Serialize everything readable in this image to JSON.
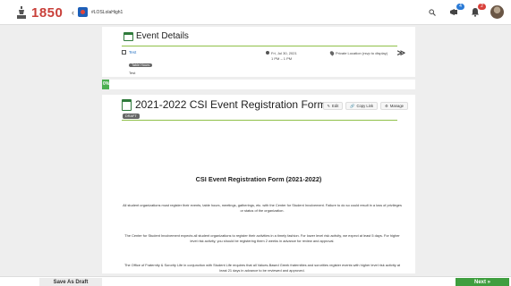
{
  "header": {
    "logo_text": "1850",
    "org_name": "#LOSLolaHigh1",
    "notification_badge": "4",
    "message_badge": "2"
  },
  "event_details": {
    "title": "Event Details",
    "event_link": "Test",
    "event_tag": "Table Hours",
    "event_sub": "Test",
    "date": "Fri, Jul 30, 2021",
    "time": "1 PM – 1 PM",
    "location": "Private Location (rsvp to display)"
  },
  "progress": {
    "label": "0%",
    "value_percent": 0
  },
  "form": {
    "title": "2021-2022 CSI Event Registration Form",
    "status": "DRAFT",
    "actions": {
      "edit": "Edit",
      "copy_link": "Copy Link",
      "manage": "Manage"
    },
    "heading": "CSI Event Registration Form (2021-2022)",
    "paragraphs": {
      "p1": "All student organizations must register their events, table hours, meetings, gatherings, etc. with the Center for Student Involvement. Failure to do so could result in a loss of privileges or status of the organization.",
      "p2": "The Center for Student Involvement expects all student organizations to register their activities in a timely fashion. For lower level risk activity, we expect at least 5 days. For higher level risk activity, you should be registering them 2 weeks in advance for review and approval.",
      "p3": "The Office of Fraternity & Sorority Life in conjunction with Student Life requires that all Values-Based Greek fraternities and sororities register events with higher level risk activity at least 21 days in advance to be reviewed and approved."
    }
  },
  "footer": {
    "save_draft": "Save As Draft",
    "next": "Next »"
  },
  "colors": {
    "brand": "#c9403a",
    "accent_green": "#8fc049",
    "next_button": "#3f9e3f"
  }
}
